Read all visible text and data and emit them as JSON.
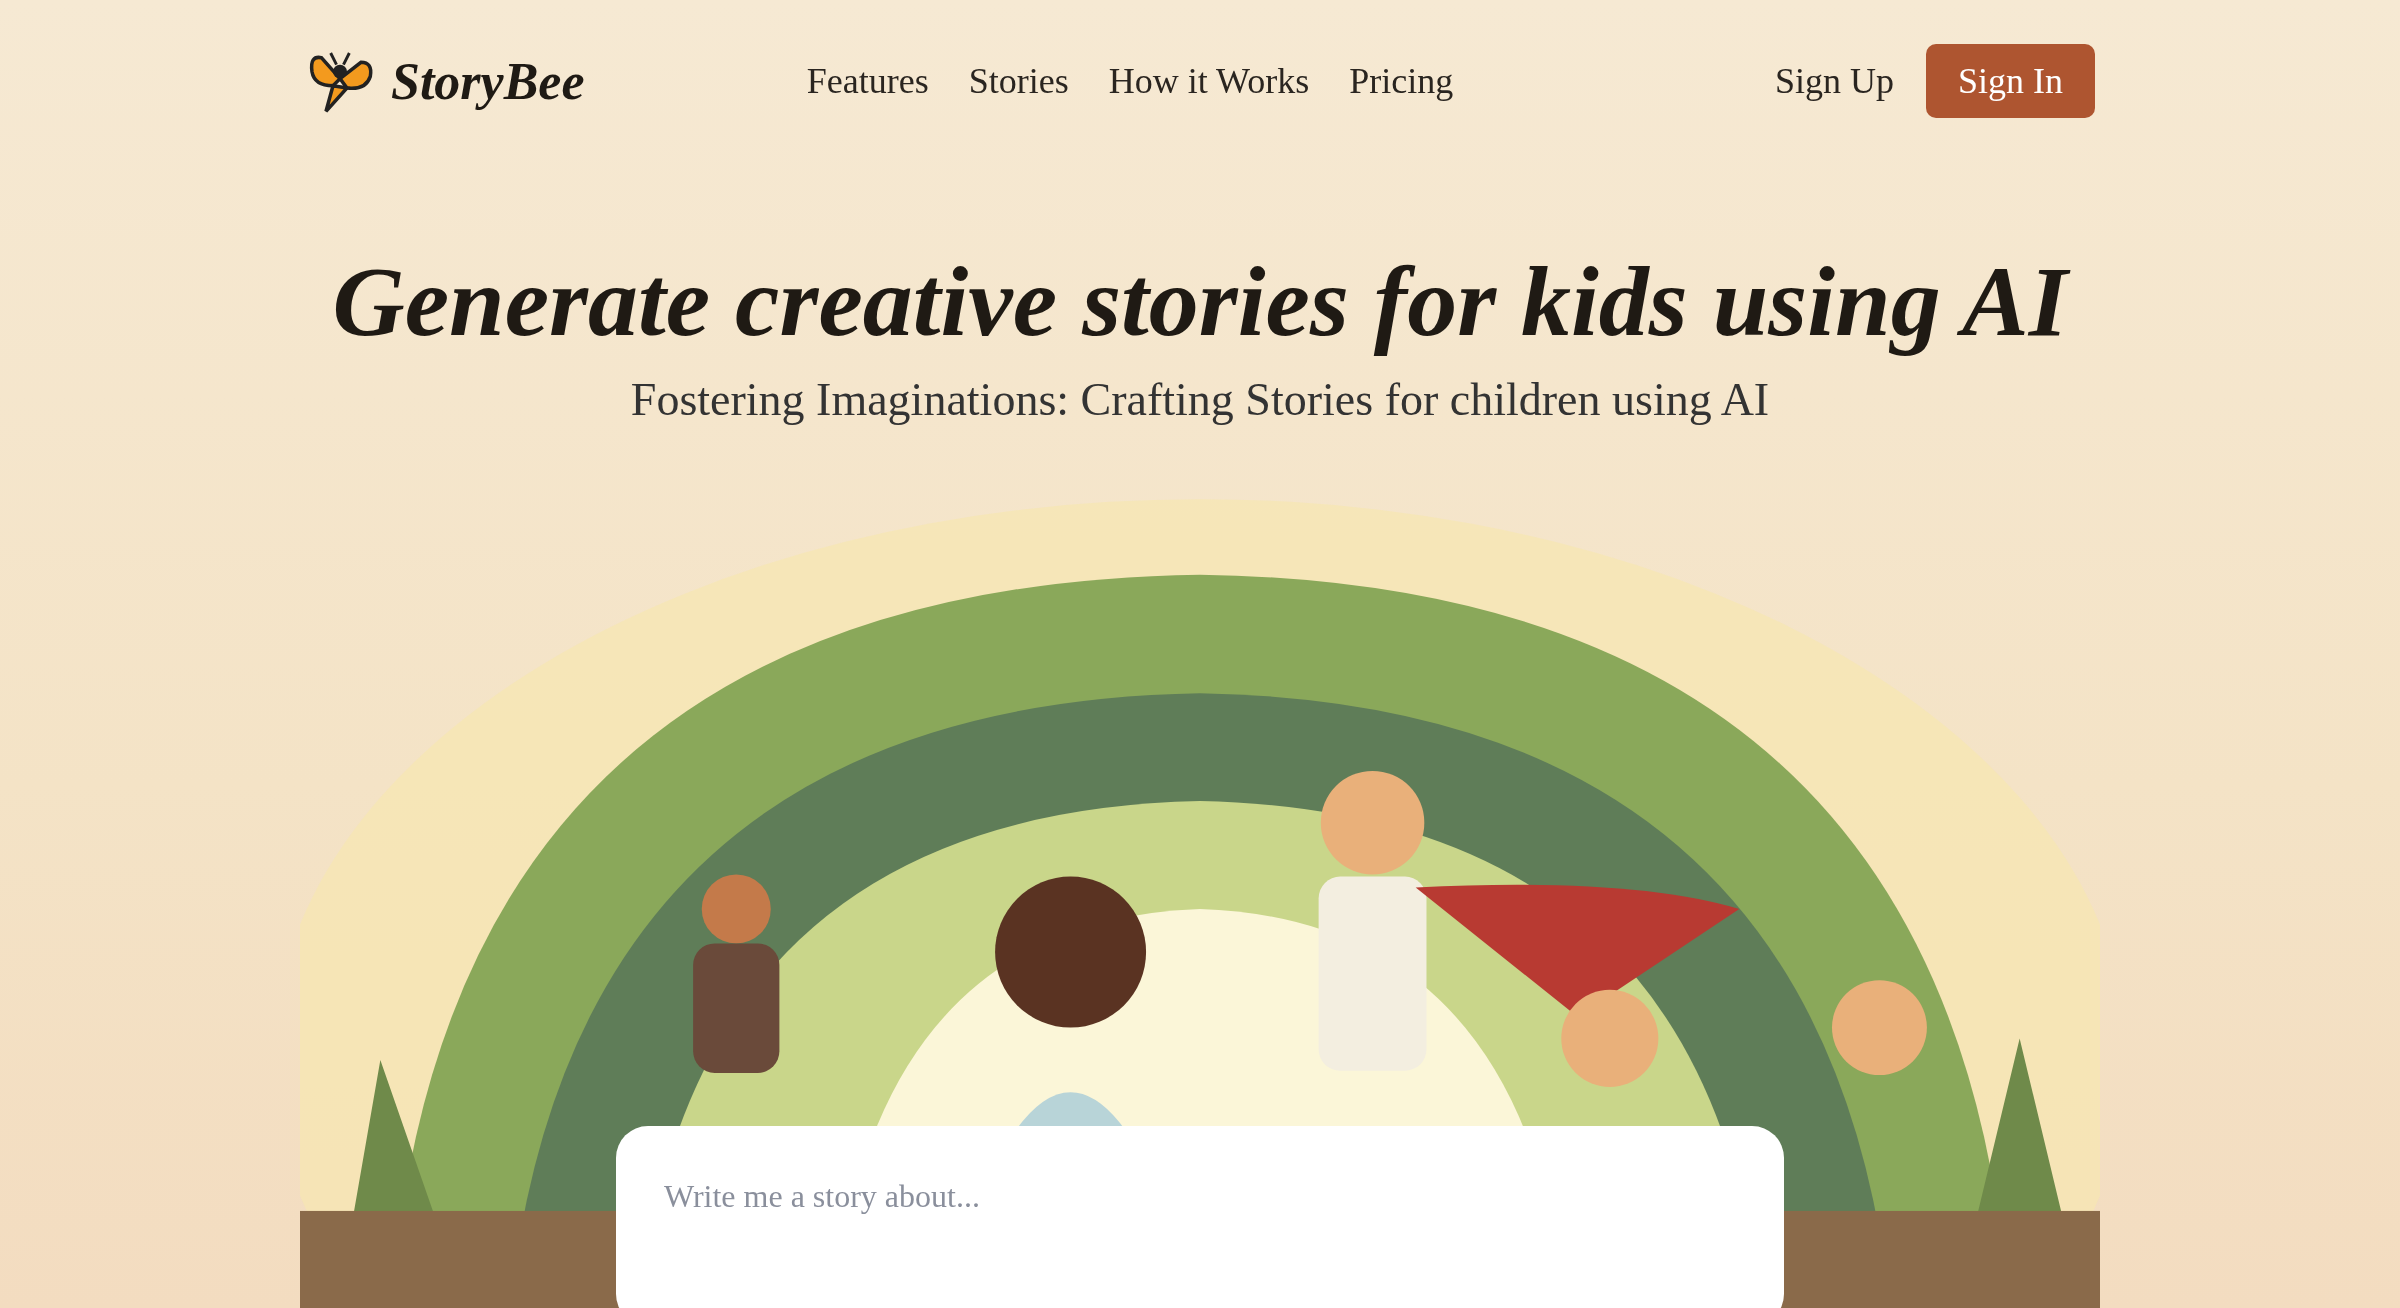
{
  "brand": {
    "name": "StoryBee"
  },
  "nav": {
    "links": [
      {
        "label": "Features"
      },
      {
        "label": "Stories"
      },
      {
        "label": "How it Works"
      },
      {
        "label": "Pricing"
      }
    ],
    "sign_up": "Sign Up",
    "sign_in": "Sign In"
  },
  "hero": {
    "title": "Generate creative stories for kids using AI",
    "subtitle": "Fostering Imaginations: Crafting Stories for children using AI"
  },
  "prompt": {
    "placeholder": "Write me a story about..."
  }
}
